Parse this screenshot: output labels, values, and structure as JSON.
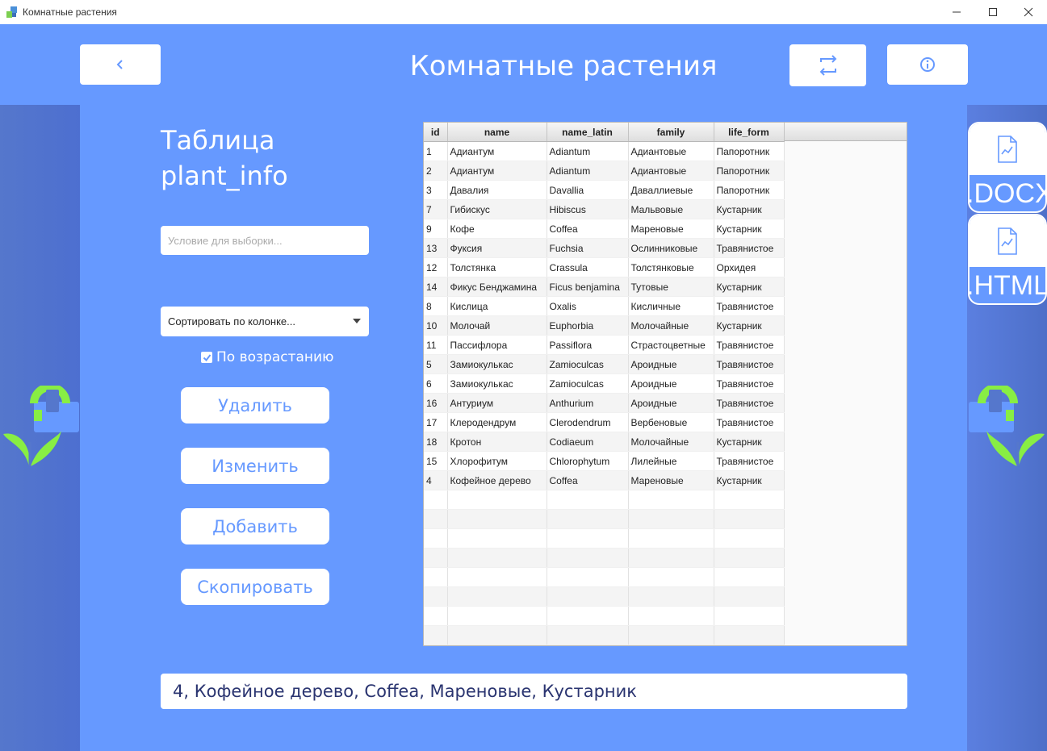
{
  "window": {
    "title": "Комнатные растения"
  },
  "header": {
    "title": "Комнатные растения",
    "back_icon": "chevron-left-icon",
    "swap_icon": "swap-arrows-icon",
    "info_icon": "info-icon"
  },
  "sidebar": {
    "table_title": "Таблица plant_info",
    "filter_placeholder": "Условие для выборки...",
    "filter_value": "",
    "sort_select": "Сортировать по колонке...",
    "ascending_label": "По возрастанию",
    "ascending_checked": true,
    "buttons": {
      "delete": "Удалить",
      "edit": "Изменить",
      "add": "Добавить",
      "copy": "Скопировать"
    }
  },
  "table": {
    "columns": [
      "id",
      "name",
      "name_latin",
      "family",
      "life_form"
    ],
    "rows": [
      [
        "1",
        "Адиантум",
        "Adiantum",
        "Адиантовые",
        "Папоротник"
      ],
      [
        "2",
        "Адиантум",
        "Adiantum",
        "Адиантовые",
        "Папоротник"
      ],
      [
        "3",
        "Давалия",
        "Davallia",
        "Даваллиевые",
        "Папоротник"
      ],
      [
        "7",
        "Гибискус",
        "Hibiscus",
        "Мальвовые",
        "Кустарник"
      ],
      [
        "9",
        "Кофе",
        "Coffea",
        "Мареновые",
        "Кустарник"
      ],
      [
        "13",
        "Фуксия",
        "Fuchsia",
        "Ослинниковые",
        "Травянистое"
      ],
      [
        "12",
        "Толстянка",
        "Crassula",
        "Толстянковые",
        "Орхидея"
      ],
      [
        "14",
        "Фикус Бенджамина",
        "Ficus benjamina",
        "Тутовые",
        "Кустарник"
      ],
      [
        "8",
        "Кислица",
        "Oxalis",
        "Кисличные",
        "Травянистое"
      ],
      [
        "10",
        "Молочай",
        "Euphorbia",
        "Молочайные",
        "Кустарник"
      ],
      [
        "11",
        "Пассифлора",
        "Passiflora",
        "Страстоцветные",
        "Травянистое"
      ],
      [
        "5",
        "Замиокулькас",
        "Zamioculcas",
        "Ароидные",
        "Травянистое"
      ],
      [
        "6",
        "Замиокулькас",
        "Zamioculcas",
        "Ароидные",
        "Травянистое"
      ],
      [
        "16",
        "Антуриум",
        "Anthurium",
        "Ароидные",
        "Травянистое"
      ],
      [
        "17",
        "Клеродендрум",
        "Clerodendrum",
        "Вербеновые",
        "Травянистое"
      ],
      [
        "18",
        "Кротон",
        "Codiaeum",
        "Молочайные",
        "Кустарник"
      ],
      [
        "15",
        "Хлорофитум",
        "Chlorophytum",
        "Лилейные",
        "Травянистое"
      ],
      [
        "4",
        "Кофейное дерево",
        "Coffea",
        "Мареновые",
        "Кустарник"
      ]
    ],
    "empty_rows": 8
  },
  "selected_record": "4, Кофейное дерево, Coffea, Мареновые, Кустарник",
  "export": {
    "docx_label": ".DOCX",
    "html_label": ".HTML",
    "icon": "document-chart-icon"
  },
  "colors": {
    "primary": "#6699ff",
    "side_strip": "#5577cc",
    "plant_green": "#88ee44",
    "selected_text": "#2a3470"
  }
}
